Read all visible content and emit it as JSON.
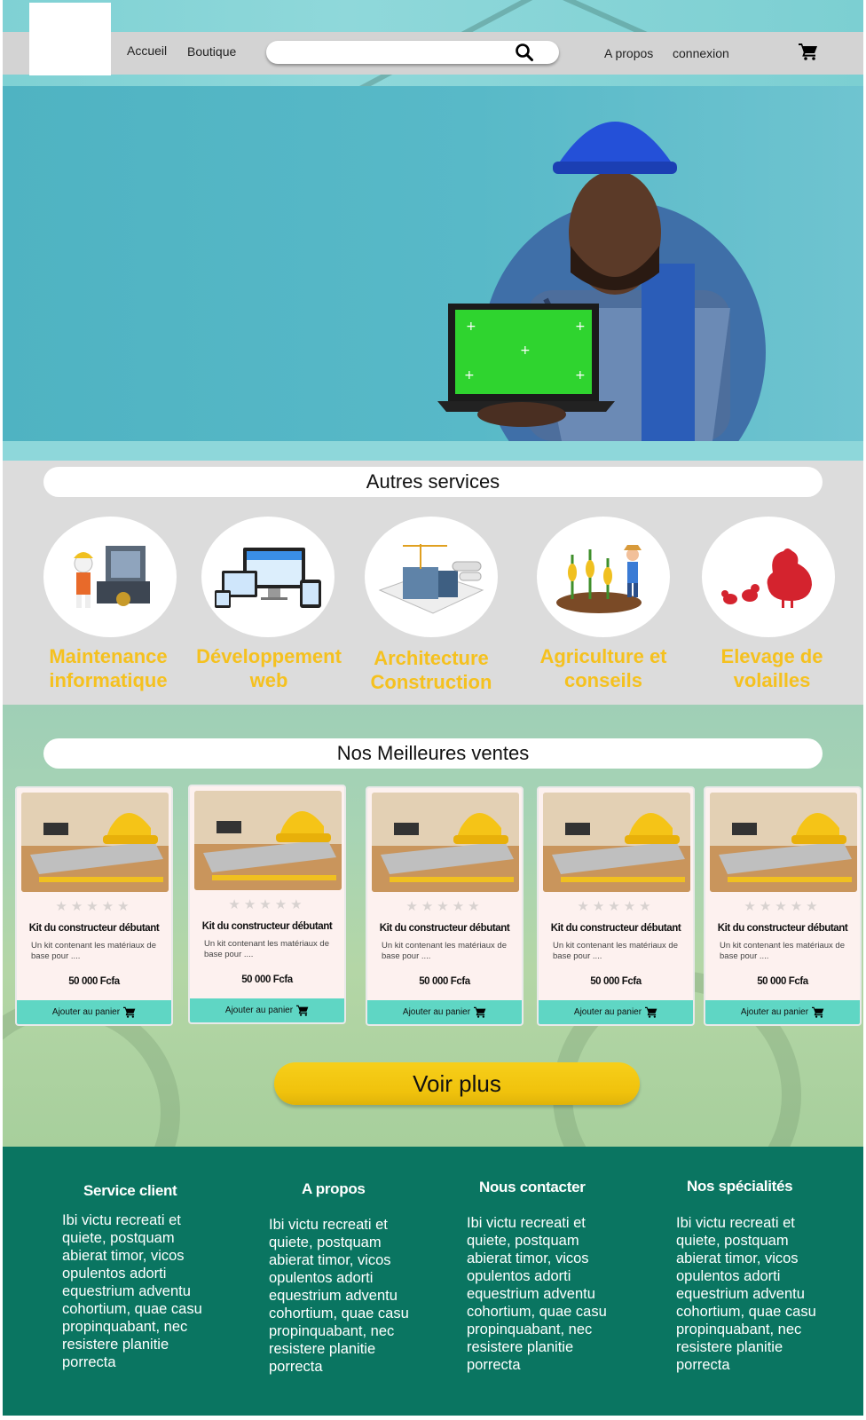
{
  "nav": {
    "links": [
      "Accueil",
      "Boutique",
      "A propos",
      "connexion"
    ],
    "search_placeholder": "",
    "icons": [
      "search-icon",
      "cart-icon"
    ]
  },
  "services": {
    "title": "Autres services",
    "items": [
      {
        "label": "Maintenance informatique",
        "icon": "computer-repair-icon"
      },
      {
        "label": "Développement web",
        "icon": "responsive-devices-icon"
      },
      {
        "label": "Architecture Construction",
        "icon": "building-plans-icon"
      },
      {
        "label": "Agriculture et conseils",
        "icon": "farmer-corn-icon"
      },
      {
        "label": "Elevage de volailles",
        "icon": "hen-chicks-icon"
      }
    ]
  },
  "sales": {
    "title": "Nos Meilleures ventes",
    "products": [
      {
        "name": "Kit du constructeur débutant",
        "desc": "Un kit contenant les matériaux de base pour ....",
        "price": "50 000 Fcfa",
        "button": "Ajouter au panier",
        "rating": 0
      },
      {
        "name": "Kit du constructeur débutant",
        "desc": "Un kit contenant les matériaux de base pour ....",
        "price": "50 000 Fcfa",
        "button": "Ajouter au panier",
        "rating": 0
      },
      {
        "name": "Kit du constructeur débutant",
        "desc": "Un kit contenant les matériaux de base pour ....",
        "price": "50 000 Fcfa",
        "button": "Ajouter au panier",
        "rating": 0
      },
      {
        "name": "Kit du constructeur débutant",
        "desc": "Un kit contenant les matériaux de base pour ....",
        "price": "50 000 Fcfa",
        "button": "Ajouter au panier",
        "rating": 0
      },
      {
        "name": "Kit du constructeur débutant",
        "desc": "Un kit contenant les matériaux de base pour ....",
        "price": "50 000 Fcfa",
        "button": "Ajouter au panier",
        "rating": 0
      }
    ],
    "more_button": "Voir plus"
  },
  "footer": {
    "columns": [
      {
        "title": "Service client",
        "text": "Ibi victu recreati et quiete, postquam abierat timor, vicos opulentos adorti equestrium adventu cohortium, quae casu propinquabant, nec resistere planitie porrecta"
      },
      {
        "title": "A propos",
        "text": "Ibi victu recreati et quiete, postquam abierat timor, vicos opulentos adorti equestrium adventu cohortium, quae casu propinquabant, nec resistere planitie porrecta"
      },
      {
        "title": "Nous contacter",
        "text": "Ibi victu recreati et quiete, postquam abierat timor, vicos opulentos adorti equestrium adventu cohortium, quae casu propinquabant, nec resistere planitie porrecta"
      },
      {
        "title": "Nos spécialités",
        "text": "Ibi victu recreati et quiete, postquam abierat timor, vicos opulentos adorti equestrium adventu cohortium, quae casu propinquabant, nec resistere planitie porrecta"
      }
    ]
  },
  "colors": {
    "accent_yellow": "#f5c11f",
    "teal_button": "#5fd6c4",
    "footer_green": "#0a7561",
    "nav_gray": "#d3d3d3"
  }
}
